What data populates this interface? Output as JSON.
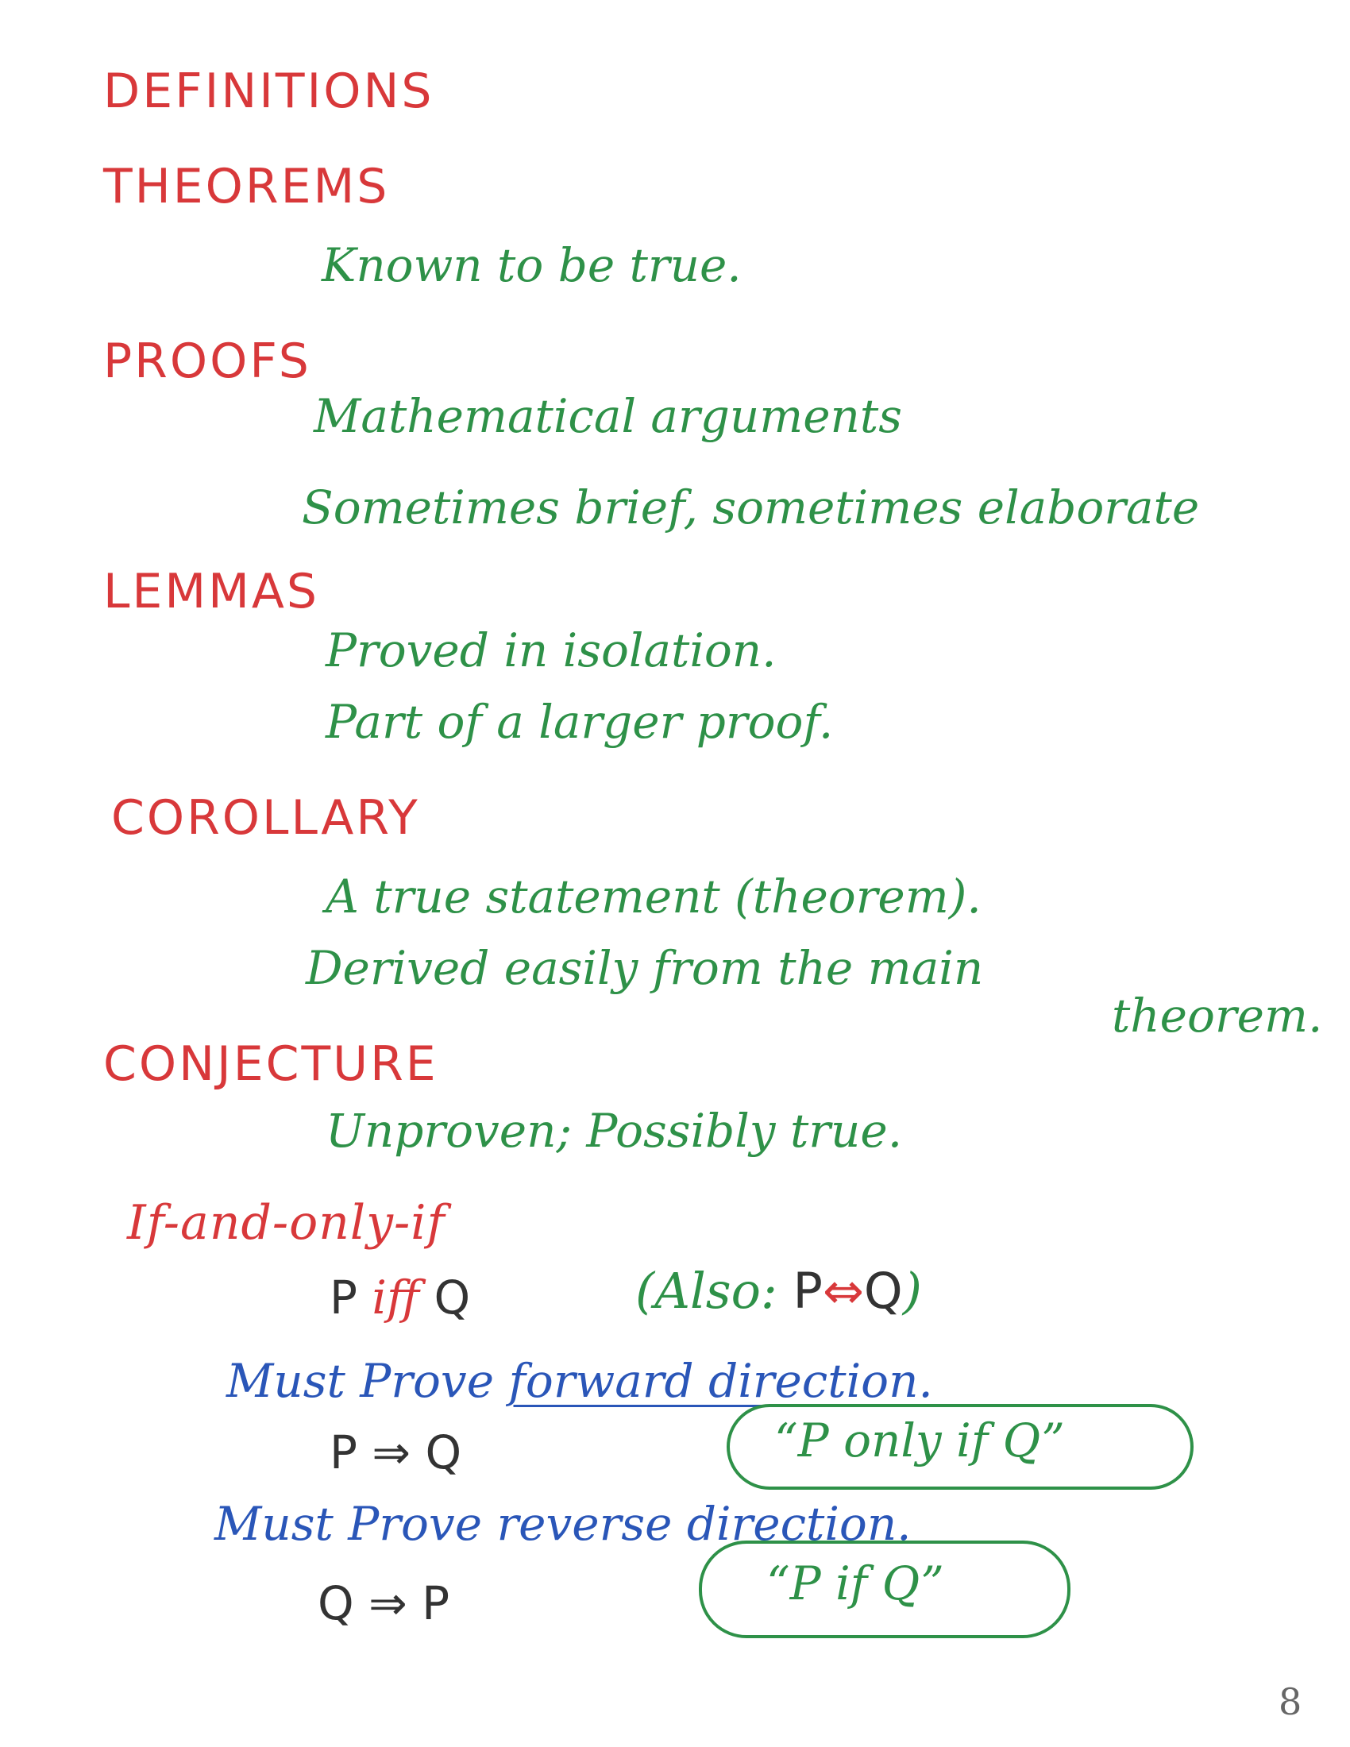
{
  "definitions": {
    "heading": "DEFINITIONS"
  },
  "theorems": {
    "heading": "THEOREMS",
    "note": "Known to be true."
  },
  "proofs": {
    "heading": "PROOFS",
    "line1": "Mathematical arguments",
    "line2": "Sometimes brief, sometimes elaborate"
  },
  "lemmas": {
    "heading": "LEMMAS",
    "line1": "Proved in isolation.",
    "line2": "Part of a larger proof."
  },
  "corollary": {
    "heading": "COROLLARY",
    "line1": "A true statement (theorem).",
    "line2": "Derived easily from the main",
    "line3": "theorem."
  },
  "conjecture": {
    "heading": "CONJECTURE",
    "line1": "Unproven; Possibly true."
  },
  "iff": {
    "heading": "If-and-only-if",
    "p": "P",
    "iff": "iff",
    "q": "Q",
    "also_open": "(Also: ",
    "also_p": "P",
    "also_arrow": "⇔",
    "also_q": "Q",
    "also_close": ")"
  },
  "forward": {
    "line1a": "Must Prove",
    "line1b": "forward direction.",
    "implication": "P ⇒ Q",
    "quote": "“P only if Q”"
  },
  "reverse": {
    "line1a": "Must Prove",
    "line1b": "reverse direction.",
    "implication": "Q ⇒ P",
    "quote": "“P if Q”"
  },
  "page_number": "8",
  "colors": {
    "heading": "#d8383a",
    "note": "#2e9148",
    "emphasis": "#2a56b8",
    "symbol": "#333333"
  }
}
